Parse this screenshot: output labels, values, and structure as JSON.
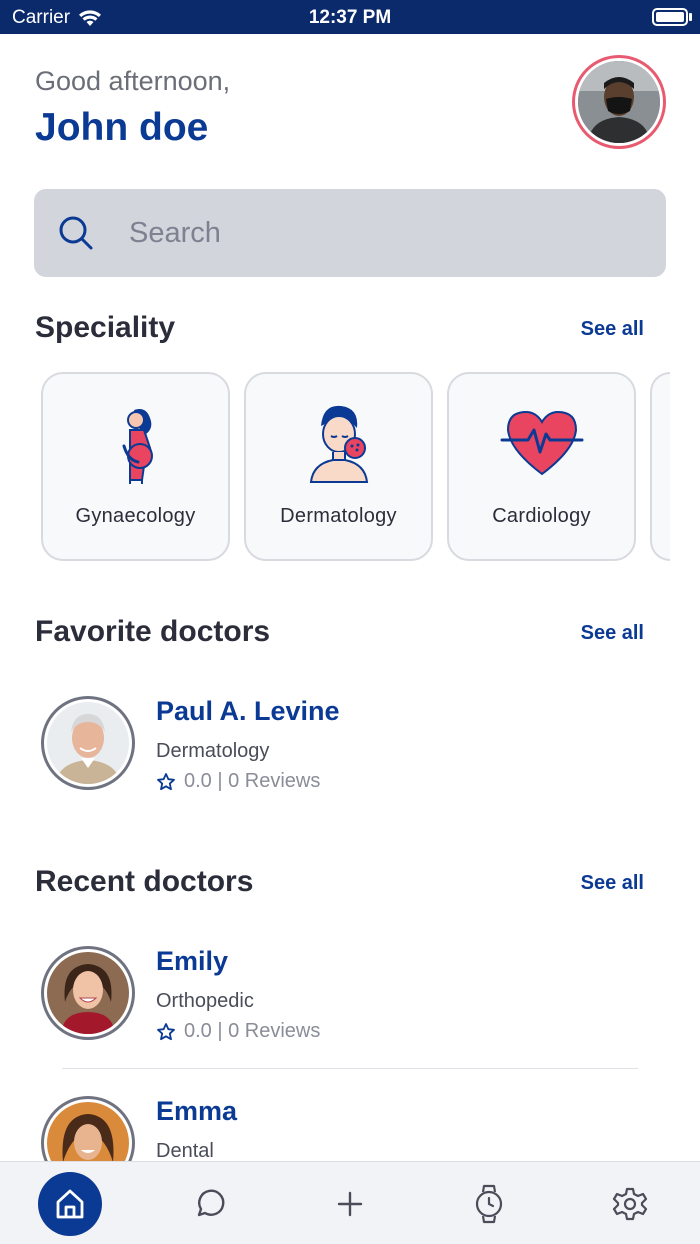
{
  "status_bar": {
    "carrier": "Carrier",
    "time": "12:37 PM"
  },
  "header": {
    "greeting": "Good afternoon,",
    "user_name": "John doe"
  },
  "search": {
    "placeholder": "Search",
    "value": ""
  },
  "speciality": {
    "title": "Speciality",
    "see_all": "See all",
    "items": [
      {
        "label": "Gynaecology",
        "icon": "pregnant-woman-icon"
      },
      {
        "label": "Dermatology",
        "icon": "face-skin-icon"
      },
      {
        "label": "Cardiology",
        "icon": "heart-pulse-icon"
      }
    ]
  },
  "favorite_doctors": {
    "title": "Favorite doctors",
    "see_all": "See all",
    "items": [
      {
        "name": "Paul A. Levine",
        "speciality": "Dermatology",
        "rating": "0.0 | 0 Reviews"
      }
    ]
  },
  "recent_doctors": {
    "title": "Recent doctors",
    "see_all": "See all",
    "items": [
      {
        "name": "Emily",
        "speciality": "Orthopedic",
        "rating": "0.0 | 0 Reviews"
      },
      {
        "name": "Emma",
        "speciality": "Dental"
      }
    ]
  },
  "tab_bar": {
    "items": [
      "home-icon",
      "chat-icon",
      "plus-icon",
      "watch-icon",
      "settings-icon"
    ],
    "active": "home-icon"
  },
  "colors": {
    "primary": "#0b3a94",
    "status_bar": "#0b2a6b",
    "accent": "#e94560",
    "avatar_ring": "#e85a6f"
  }
}
